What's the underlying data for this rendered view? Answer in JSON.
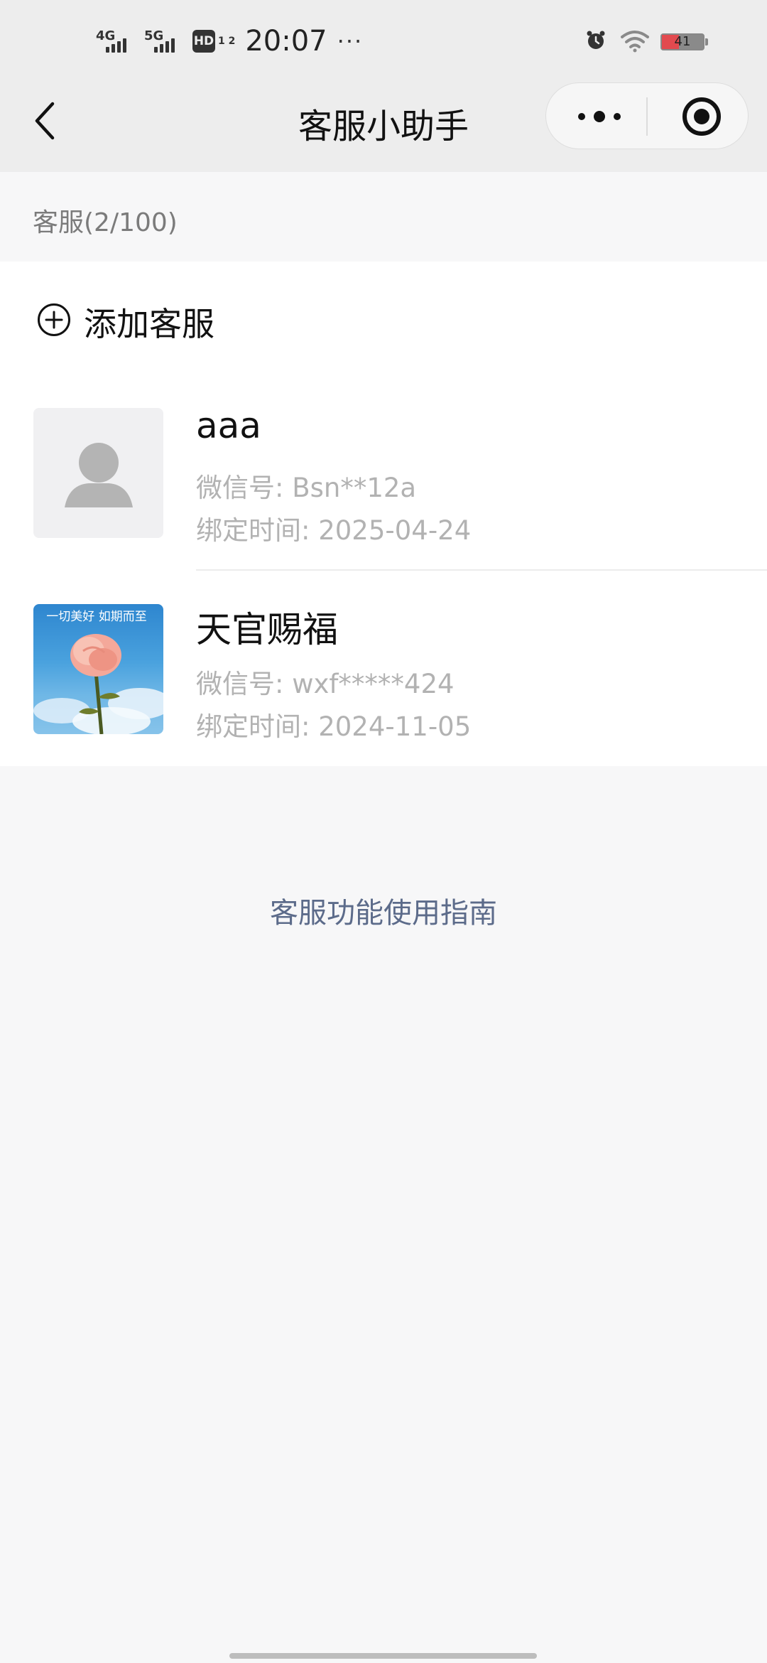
{
  "status_bar": {
    "net1": "4G",
    "net2": "5G",
    "hd": "HD",
    "hd_sub": "1 2",
    "time": "20:07",
    "dots": "···",
    "battery_pct": "41"
  },
  "nav": {
    "title": "客服小助手"
  },
  "section": {
    "header": "客服(2/100)"
  },
  "add": {
    "label": "添加客服"
  },
  "agents": [
    {
      "name": "aaa",
      "wechat": "微信号: Bsn**12a",
      "bind_time": "绑定时间: 2025-04-24",
      "avatar": "default-person-avatar"
    },
    {
      "name": "天官赐福",
      "wechat": "微信号: wxf*****424",
      "bind_time": "绑定时间: 2024-11-05",
      "avatar": "rose-photo-avatar",
      "avatar_caption": "一切美好 如期而至"
    }
  ],
  "guide": {
    "label": "客服功能使用指南"
  },
  "colors": {
    "nav_bg": "#ededed",
    "page_bg": "#f7f7f8",
    "card_bg": "#ffffff",
    "link": "#5c6b8a",
    "secondary_text": "#b2b2b2"
  },
  "icons": {
    "back": "chevron-left-icon",
    "more": "more-dots-icon",
    "close": "target-close-icon",
    "add": "plus-circle-icon"
  }
}
